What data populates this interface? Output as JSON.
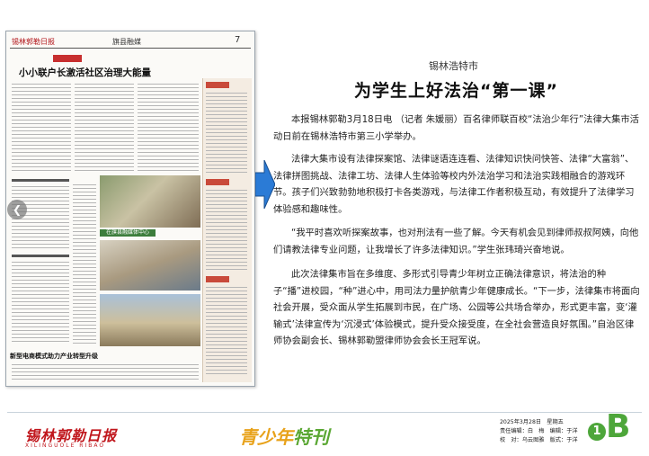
{
  "thumbnail": {
    "masthead": "锡林郭勒日报",
    "section": "旗县融媒",
    "page_number": "7",
    "headline": "小小联户长激活社区治理大能量",
    "banner": "在旗县融媒体中心",
    "bottom_headline": "新型电商模式助力产业转型升级"
  },
  "article": {
    "kicker": "锡林浩特市",
    "headline": "为学生上好法治“第一课”",
    "paragraphs": [
      "本报锡林郭勒3月18日电 （记者 朱媛丽）百名律师联百校“法治少年行”法律大集市活动日前在锡林浩特市第三小学举办。",
      "法律大集市设有法律探案馆、法律谜语连连看、法律知识快问快答、法律“大富翁”、法律拼图挑战、法律工坊、法律人生体验等校内外法治学习和法治实践相融合的游戏环节。孩子们兴致勃勃地积极打卡各类游戏，与法律工作者积极互动，有效提升了法律学习体验感和趣味性。",
      "“我平时喜欢听探案故事，也对刑法有一些了解。今天有机会见到律师叔叔阿姨，向他们请教法律专业问题，让我增长了许多法律知识。”学生张玮琦兴奋地说。",
      "此次法律集市旨在多维度、多形式引导青少年树立正确法律意识，将法治的种子“播”进校园，“种”进心中，用司法力量护航青少年健康成长。“下一步，法律集市将面向社会开展，受众面从学生拓展到市民，在广场、公园等公共场合举办，形式更丰富，变‘灌输式’法律宣传为‘沉浸式’体验模式，提升受众接受度，在全社会营造良好氛围。”自治区律师协会副会长、锡林郭勒盟律师协会会长王冠军说。"
    ]
  },
  "footer": {
    "logo": "锡林郭勒日报",
    "logo_sub": "XILINGUOLE RIBAO",
    "special_a": "青少年",
    "special_b": "特刊",
    "date": "2025年3月28日　星期五",
    "editor": "责任编辑：白　梅　编辑：于洋",
    "proof": "校　对：乌云图雅　版式：于洋",
    "page_num": "1",
    "page_letter": "B"
  },
  "colors": {
    "accent_red": "#c0161c",
    "accent_green": "#4da63a",
    "arrow_blue": "#2b7bd6"
  }
}
